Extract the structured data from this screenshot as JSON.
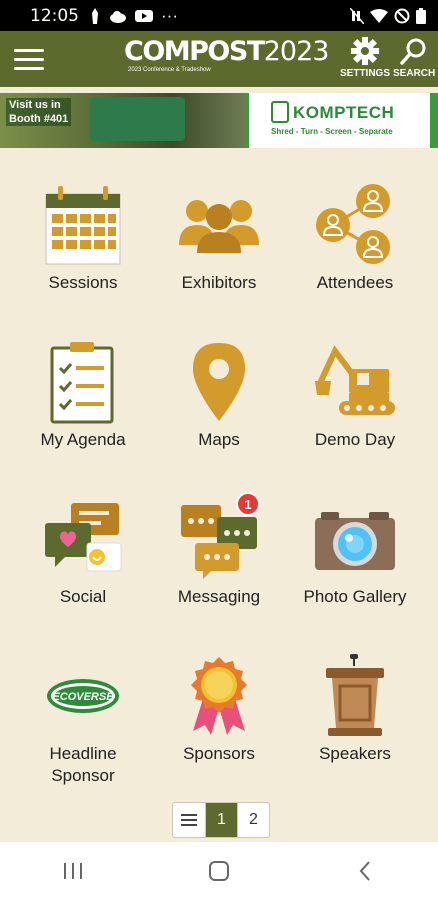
{
  "status": {
    "time": "12:05",
    "more": "···"
  },
  "header": {
    "brand_title": "COMPOST",
    "brand_year": "2023",
    "brand_sub": "2023 Conference & Tradeshow",
    "settings_label": "SETTINGS",
    "search_label": "SEARCH",
    "accent": "#5d6a2d"
  },
  "banner": {
    "visit_line1": "Visit us in",
    "visit_line2": "Booth #401",
    "company": "KOMPTECH",
    "tagline": "Shred - Turn - Screen - Separate"
  },
  "tiles": [
    {
      "label": "Sessions",
      "icon": "calendar-icon"
    },
    {
      "label": "Exhibitors",
      "icon": "group-icon"
    },
    {
      "label": "Attendees",
      "icon": "network-icon"
    },
    {
      "label": "My Agenda",
      "icon": "checklist-icon"
    },
    {
      "label": "Maps",
      "icon": "map-pin-icon"
    },
    {
      "label": "Demo Day",
      "icon": "excavator-icon"
    },
    {
      "label": "Social",
      "icon": "chat-heart-icon"
    },
    {
      "label": "Messaging",
      "icon": "chat-bubbles-icon",
      "badge": "1"
    },
    {
      "label": "Photo Gallery",
      "icon": "camera-icon"
    },
    {
      "label": "Headline\nSponsor",
      "label_line1": "Headline",
      "label_line2": "Sponsor",
      "icon": "ecoverse-logo",
      "logo_text": "ECOVERSE"
    },
    {
      "label": "Sponsors",
      "icon": "ribbon-icon"
    },
    {
      "label": "Speakers",
      "icon": "podium-icon"
    }
  ],
  "pager": {
    "pages": [
      "1",
      "2"
    ],
    "active": "1"
  }
}
